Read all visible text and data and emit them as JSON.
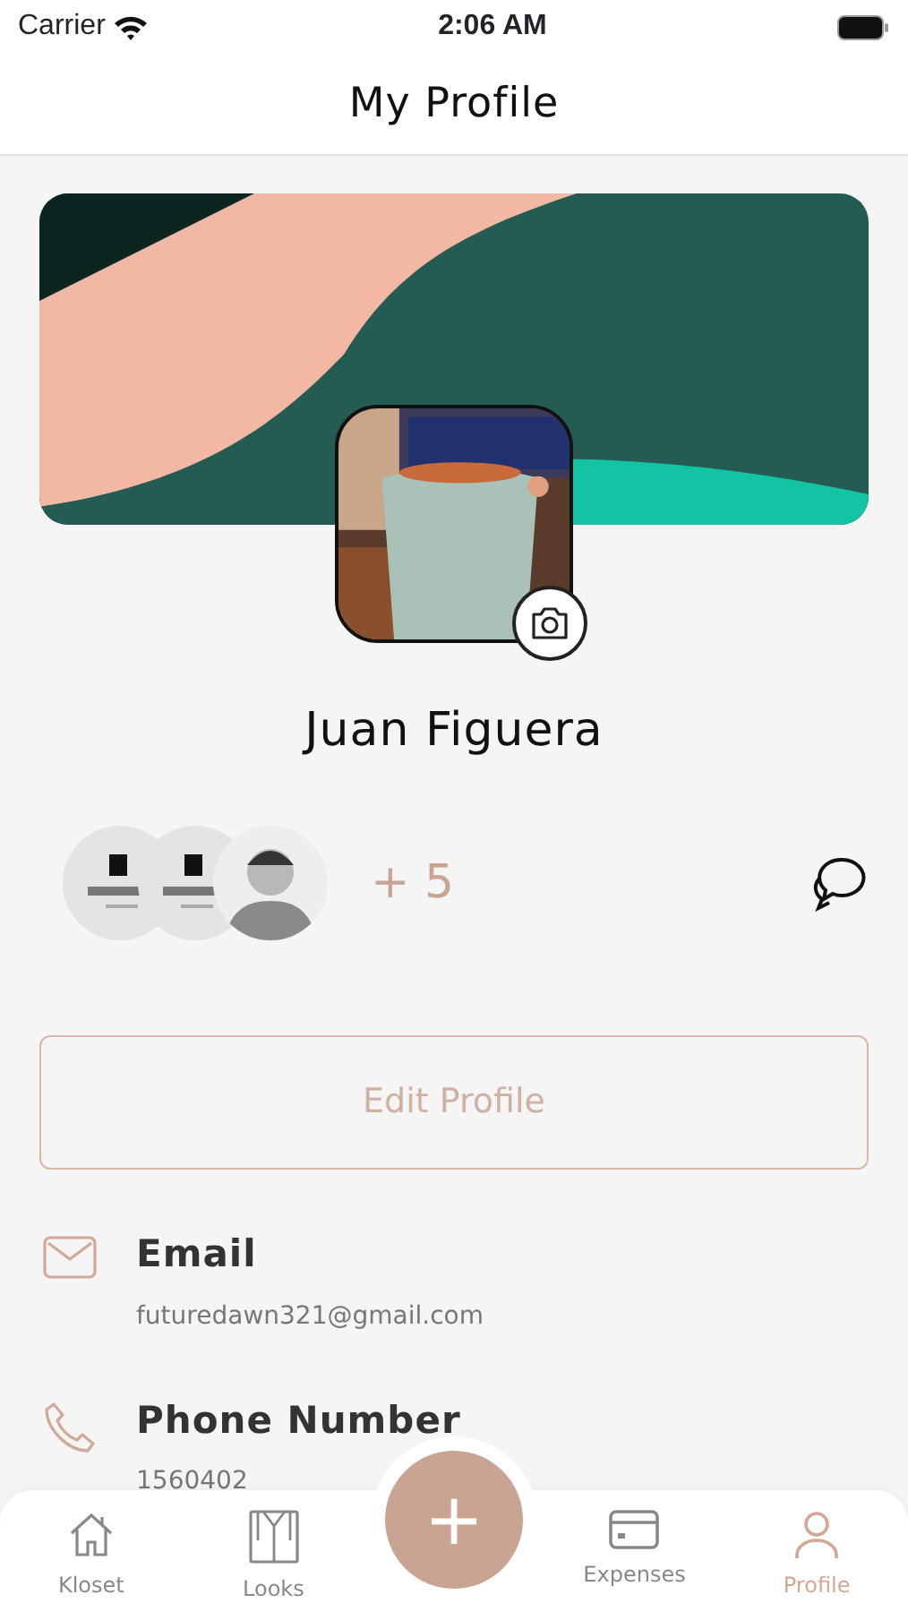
{
  "status_bar": {
    "carrier": "Carrier",
    "time": "2:06 AM"
  },
  "header": {
    "title": "My Profile"
  },
  "profile": {
    "name": "Juan Figuera"
  },
  "friends": {
    "avatars": [
      {
        "kind": "logo"
      },
      {
        "kind": "logo"
      },
      {
        "kind": "person"
      }
    ],
    "more": "+ 5"
  },
  "edit_button": "Edit Profile",
  "details": [
    {
      "kind": "email",
      "label": "Email",
      "value": "futuredawn321@gmail.com"
    },
    {
      "kind": "phone",
      "label": "Phone Number",
      "value": "1560402"
    }
  ],
  "tabs": [
    {
      "kind": "home",
      "label": "Kloset",
      "selected": false
    },
    {
      "kind": "shirt",
      "label": "Looks",
      "selected": false
    },
    {
      "kind": "card",
      "label": "Expenses",
      "selected": false
    },
    {
      "kind": "person",
      "label": "Profile",
      "selected": true
    }
  ],
  "fab": "+"
}
